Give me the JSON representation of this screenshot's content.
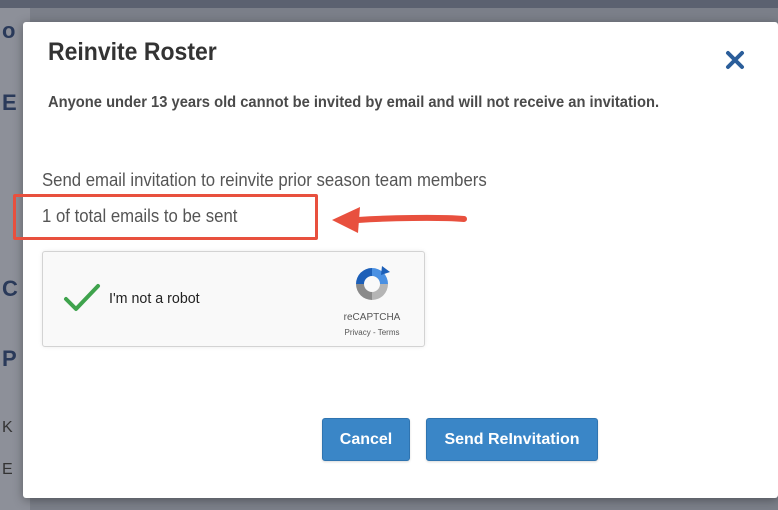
{
  "background": {
    "fragments": [
      "o",
      "E",
      "C",
      "P",
      "K",
      "E"
    ]
  },
  "modal": {
    "title": "Reinvite Roster",
    "close_icon": "close-icon",
    "warning": "Anyone under 13 years old cannot be invited by email and will not receive an invitation.",
    "description": "Send email invitation to reinvite prior season team members",
    "email_count": "1 of total emails to be sent",
    "annotation_color": "#e8503e"
  },
  "recaptcha": {
    "label": "I'm not a robot",
    "checked": true,
    "brand": "reCAPTCHA",
    "links": "Privacy - Terms"
  },
  "buttons": {
    "cancel_label": "Cancel",
    "send_label": "Send ReInvitation"
  },
  "colors": {
    "primary_button": "#3a86c7",
    "close_icon": "#2b5e9a",
    "check": "#3fa34d"
  }
}
